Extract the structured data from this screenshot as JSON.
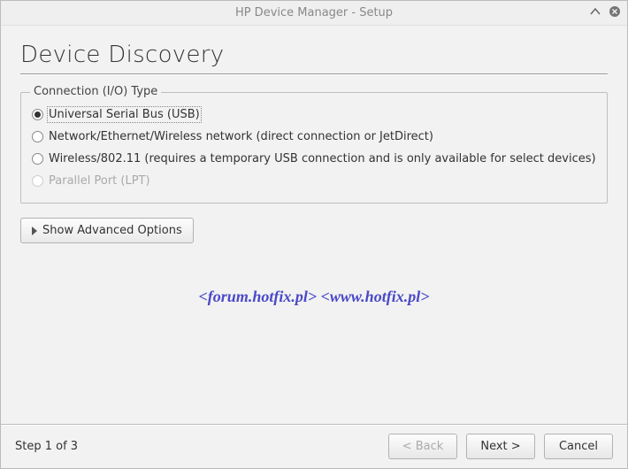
{
  "window": {
    "title": "HP Device Manager - Setup"
  },
  "page": {
    "heading": "Device Discovery"
  },
  "group": {
    "title": "Connection (I/O) Type",
    "options": {
      "usb": "Universal Serial Bus (USB)",
      "net": "Network/Ethernet/Wireless network (direct connection or JetDirect)",
      "wifi": "Wireless/802.11 (requires a temporary USB connection and is only available for select devices)",
      "lpt": "Parallel Port (LPT)"
    }
  },
  "buttons": {
    "advanced": "Show Advanced Options",
    "back": "< Back",
    "next": "Next >",
    "cancel": "Cancel"
  },
  "footer": {
    "step": "Step 1 of 3"
  },
  "watermark": "<forum.hotfix.pl> <www.hotfix.pl>"
}
